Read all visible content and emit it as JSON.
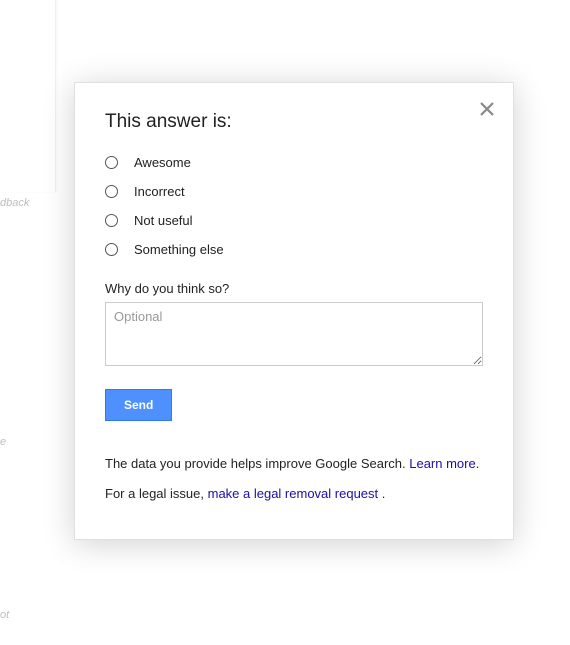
{
  "background": {
    "text1": "dback",
    "text2": "e",
    "text3": "ot"
  },
  "modal": {
    "title": "This answer is:",
    "options": [
      {
        "label": "Awesome"
      },
      {
        "label": "Incorrect"
      },
      {
        "label": "Not useful"
      },
      {
        "label": "Something else"
      }
    ],
    "prompt": "Why do you think so?",
    "textarea_placeholder": "Optional",
    "send_label": "Send",
    "footer": {
      "line1_text": "The data you provide helps improve Google Search. ",
      "line1_link": "Learn more",
      "line1_suffix": ".",
      "line2_text": "For a legal issue, ",
      "line2_link": "make a legal removal request ",
      "line2_suffix": "."
    }
  }
}
